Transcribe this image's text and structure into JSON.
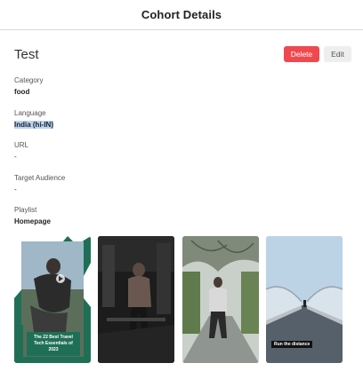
{
  "header": {
    "title": "Cohort Details"
  },
  "cohort": {
    "name": "Test"
  },
  "actions": {
    "delete_label": "Delete",
    "edit_label": "Edit"
  },
  "fields": [
    {
      "label": "Category",
      "value": "food"
    },
    {
      "label": "Language",
      "value": "India (hi-IN)"
    },
    {
      "label": "URL",
      "value": "-"
    },
    {
      "label": "Target Audience",
      "value": "-"
    },
    {
      "label": "Playlist",
      "value": "Homepage"
    }
  ],
  "thumbnails": [
    {
      "caption": "The 22 Best Travel Tech Essentials of 2023",
      "icon": "play-icon"
    },
    {
      "caption": ""
    },
    {
      "caption": ""
    },
    {
      "caption": "Run the distance"
    }
  ],
  "colors": {
    "delete": "#f0484f",
    "edit": "#eeeeee",
    "highlight": "#b9d4f3",
    "green": "#1f6f57"
  }
}
